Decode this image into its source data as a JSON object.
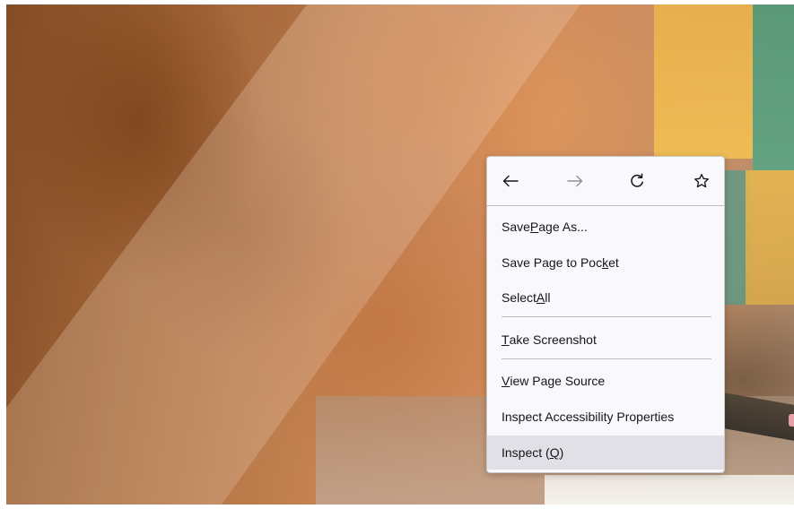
{
  "navigation": {
    "back": {
      "icon": "arrow-left-icon",
      "enabled": true
    },
    "forward": {
      "icon": "arrow-right-icon",
      "enabled": false
    },
    "reload": {
      "icon": "reload-icon"
    },
    "bookmark": {
      "icon": "star-outline-icon"
    }
  },
  "menu": {
    "items": [
      {
        "pre": "Save ",
        "key": "P",
        "post": "age As...",
        "highlighted": false
      },
      {
        "pre": "Save Page to Poc",
        "key": "k",
        "post": "et",
        "highlighted": false
      },
      {
        "pre": "Select ",
        "key": "A",
        "post": "ll",
        "highlighted": false
      },
      {
        "pre": "",
        "key": "T",
        "post": "ake Screenshot",
        "highlighted": false
      },
      {
        "pre": "",
        "key": "V",
        "post": "iew Page Source",
        "highlighted": false
      },
      {
        "pre": "Inspect Accessibility Properties",
        "key": "",
        "post": "",
        "highlighted": false
      },
      {
        "pre": "Inspect (",
        "key": "Q",
        "post": ")",
        "highlighted": true
      }
    ]
  },
  "colors": {
    "menu_background": "#f9f9fb",
    "menu_border": "#c9c9cc",
    "separator": "#bdbdc1",
    "highlight": "#e0e0e6",
    "text": "#15141a",
    "disabled_icon": "#8f8f9d"
  }
}
